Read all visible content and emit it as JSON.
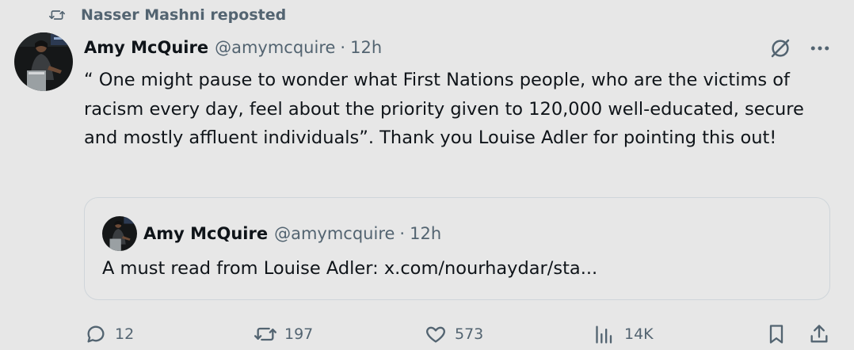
{
  "repost": {
    "icon": "repost-icon",
    "label": "Nasser Mashni reposted"
  },
  "tweet": {
    "author_name": "Amy McQuire",
    "author_handle": "@amymcquire",
    "separator": "·",
    "time": "12h",
    "text": "“ One might pause to wonder what First Nations people, who are the victims of racism every day, feel about the priority given to 120,000 well-educated, secure and mostly affluent individuals”. Thank you Louise Adler for pointing this out!",
    "icons": [
      "grok-icon",
      "more-icon"
    ]
  },
  "quote": {
    "author_name": "Amy McQuire",
    "author_handle": "@amymcquire",
    "separator": "·",
    "time": "12h",
    "text": "A must read from Louise Adler: x.com/nourhaydar/sta..."
  },
  "actions": {
    "replies": "12",
    "reposts": "197",
    "likes": "573",
    "views": "14K",
    "icons": [
      "reply-icon",
      "repost-icon",
      "like-icon",
      "views-icon",
      "bookmark-icon",
      "share-icon"
    ]
  },
  "colors": {
    "background": "#e7e7e7",
    "text_primary": "#0f1419",
    "text_secondary": "#536471",
    "quote_border": "#cfd5da"
  }
}
